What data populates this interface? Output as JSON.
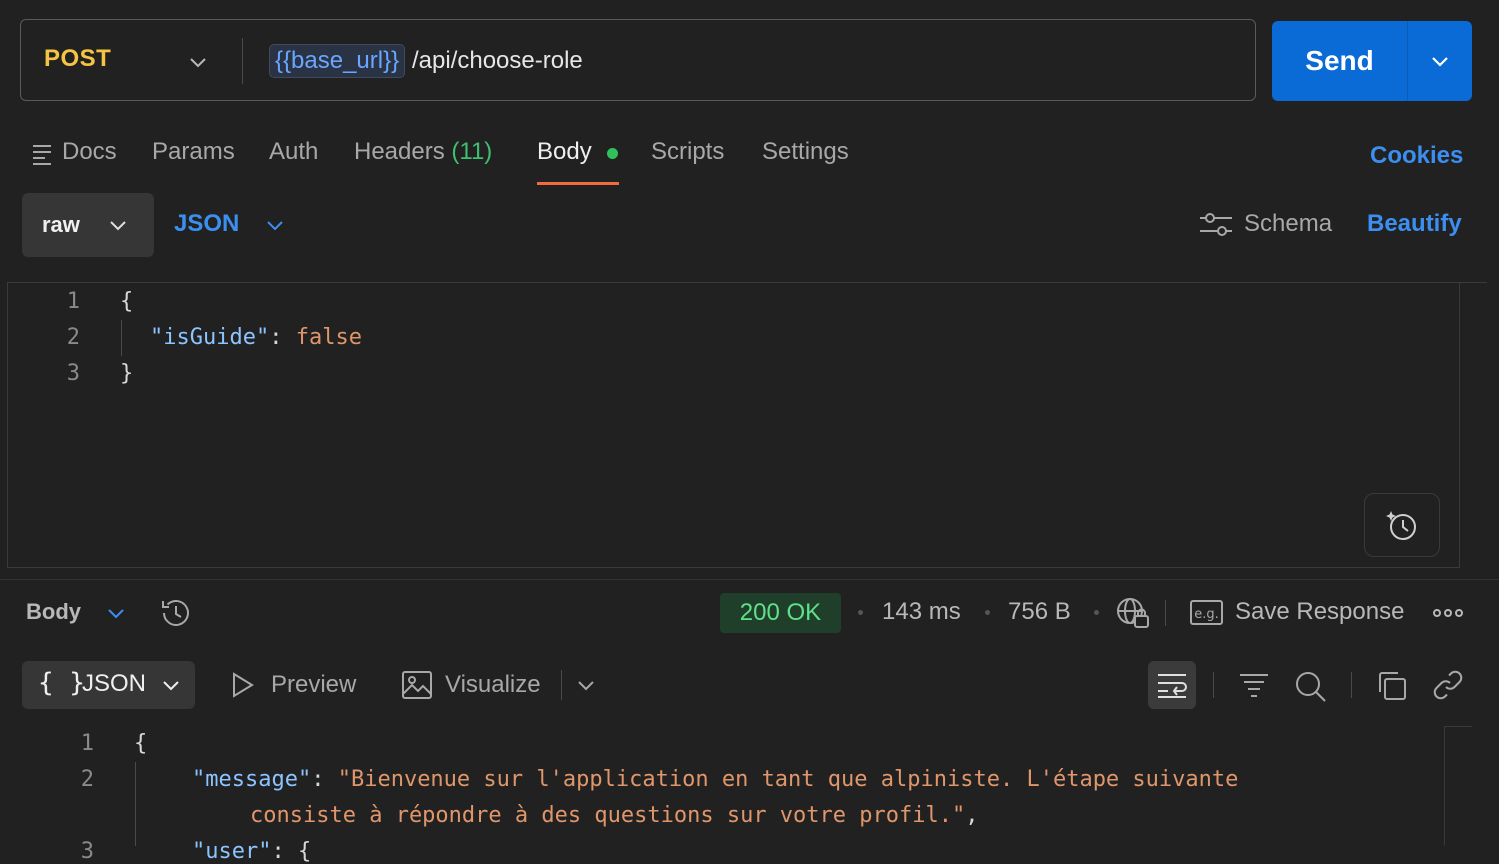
{
  "request": {
    "method": "POST",
    "url_variable": "{{base_url}}",
    "url_path": "/api/choose-role",
    "send_label": "Send"
  },
  "tabs": {
    "docs": "Docs",
    "params": "Params",
    "auth": "Auth",
    "headers": "Headers",
    "headers_count": "(11)",
    "body": "Body",
    "scripts": "Scripts",
    "settings": "Settings",
    "cookies": "Cookies"
  },
  "body_mode": {
    "raw": "raw",
    "format": "JSON",
    "schema": "Schema",
    "beautify": "Beautify"
  },
  "request_body": {
    "lines": [
      {
        "n": "1",
        "text": "{"
      },
      {
        "n": "2",
        "key": "\"isGuide\"",
        "sep": ": ",
        "value": "false"
      },
      {
        "n": "3",
        "text": "}"
      }
    ]
  },
  "response": {
    "body_label": "Body",
    "status": "200 OK",
    "time": "143 ms",
    "size": "756 B",
    "save_response": "Save Response",
    "format_label": "JSON",
    "braces": "{ }",
    "preview": "Preview",
    "visualize": "Visualize",
    "lines": [
      {
        "n": "1",
        "text": "{"
      },
      {
        "n": "2",
        "key": "\"message\"",
        "sep": ": ",
        "value": "\"Bienvenue sur l'application en tant que alpiniste. L'étape suivante",
        "cont": "consiste à répondre à des questions sur votre profil.\"",
        "trail": ","
      },
      {
        "n": "3",
        "key": "\"user\"",
        "sep": ": ",
        "text": "{"
      }
    ]
  },
  "colors": {
    "accent": "#0a6bd6",
    "link": "#3b8ff0",
    "method": "#f5c542",
    "status_ok": "#5fe08a",
    "active_tab_underline": "#f26b3a"
  }
}
